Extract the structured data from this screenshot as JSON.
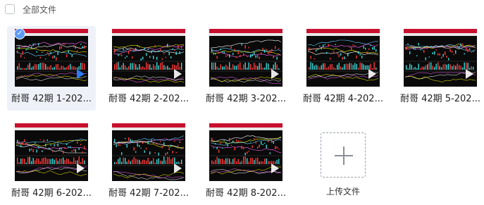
{
  "header": {
    "select_all_label": "全部文件"
  },
  "files": [
    {
      "name": "耐哥 42期 1-202...",
      "selected": true
    },
    {
      "name": "耐哥 42期 2-202...",
      "selected": false
    },
    {
      "name": "耐哥 42期 3-202...",
      "selected": false
    },
    {
      "name": "耐哥 42期 4-202...",
      "selected": false
    },
    {
      "name": "耐哥 42期 5-202...",
      "selected": false
    },
    {
      "name": "耐哥 42期 6-202...",
      "selected": false
    },
    {
      "name": "耐哥 42期 7-202...",
      "selected": false
    },
    {
      "name": "耐哥 42期 8-202...",
      "selected": false
    }
  ],
  "upload": {
    "label": "上传文件"
  },
  "colors": {
    "accent": "#2f7bf5",
    "thumb_bar": "#c8102e",
    "selected_bg": "#eef1f8"
  }
}
